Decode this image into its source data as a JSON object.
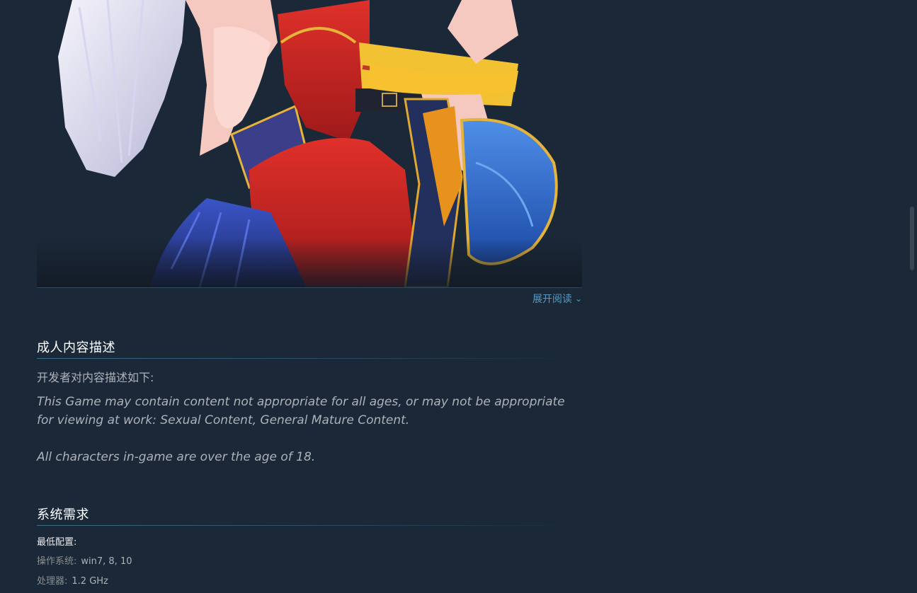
{
  "artwork": {
    "read_more_label": "展开阅读"
  },
  "mature_section": {
    "title": "成人内容描述",
    "developer_label": "开发者对内容描述如下:",
    "paragraph_1": "This Game may contain content not appropriate for all ages, or may not be appropriate for viewing at work: Sexual Content, General Mature Content.",
    "paragraph_2": "All characters in-game are over the age of 18."
  },
  "sysreq_section": {
    "title": "系统需求",
    "minimum_label": "最低配置:",
    "rows": [
      {
        "key": "操作系统:",
        "value": "win7, 8, 10"
      },
      {
        "key": "处理器:",
        "value": "1.2 GHz"
      }
    ]
  },
  "colors": {
    "background": "#1b2838",
    "title": "#ffffff",
    "link": "#67c1f5",
    "body_text": "#acb2b8"
  }
}
